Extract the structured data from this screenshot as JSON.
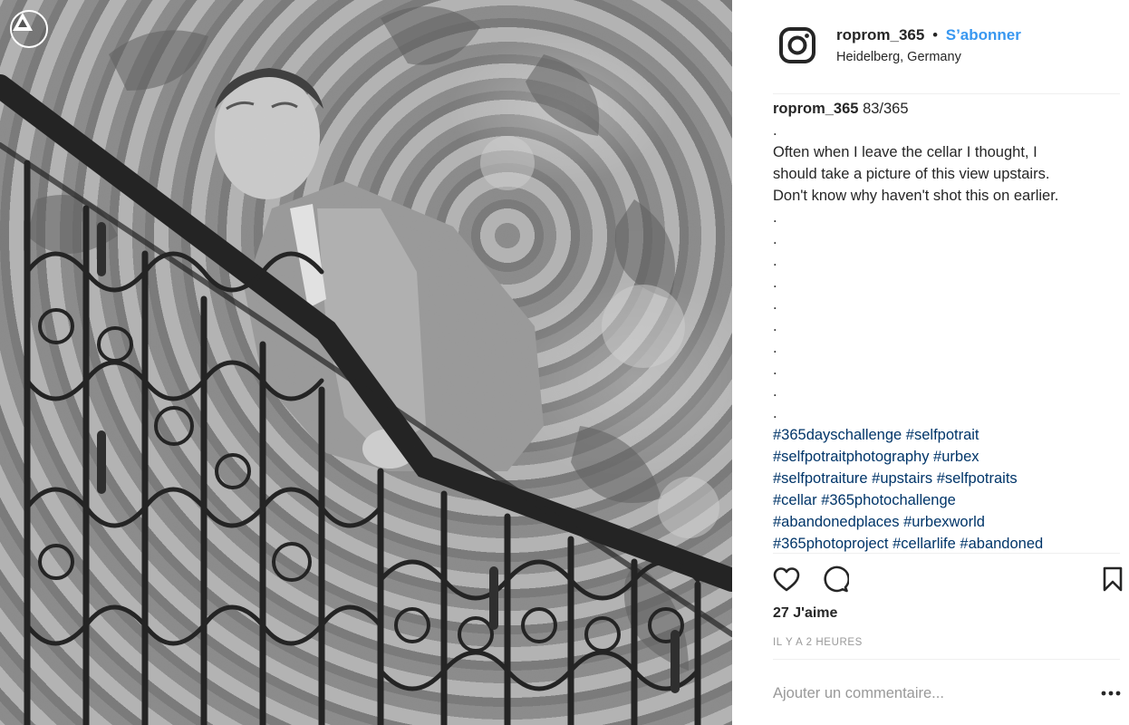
{
  "post": {
    "username": "roprom_365",
    "separator": "•",
    "follow_label": "S’abonner",
    "location": "Heidelberg, Germany"
  },
  "caption": {
    "username": "roprom_365",
    "counter": "83/365",
    "lines": [
      ".",
      "Often when I leave the cellar I thought, I",
      "should take a picture of this view upstairs.",
      "Don't know why haven't shot this on earlier.",
      ".",
      ".",
      ".",
      ".",
      ".",
      ".",
      ".",
      ".",
      ".",
      "."
    ],
    "hashtag_lines": [
      [
        "#365dayschallenge",
        "#selfpotrait"
      ],
      [
        "#selfpotraitphotography",
        "#urbex"
      ],
      [
        "#selfpotraiture",
        "#upstairs",
        "#selfpotraits"
      ],
      [
        "#cellar",
        "#365photochallenge"
      ],
      [
        "#abandonedplaces",
        "#urbexworld"
      ],
      [
        "#365photoproject",
        "#cellarlife",
        "#abandoned"
      ]
    ]
  },
  "engagement": {
    "likes": "27 J'aime",
    "time": "IL Y A 2 HEURES"
  },
  "comment": {
    "placeholder": "Ajouter un commentaire..."
  },
  "icons": {
    "avatar": "instagram-logo-icon",
    "like": "heart-icon",
    "comment": "comment-bubble-icon",
    "save": "bookmark-icon",
    "more": "more-options-icon",
    "corner": "warning-triangle-icon"
  },
  "colors": {
    "accent": "#3897f0",
    "hashtag": "#003569",
    "muted": "#999999",
    "text": "#262626"
  }
}
